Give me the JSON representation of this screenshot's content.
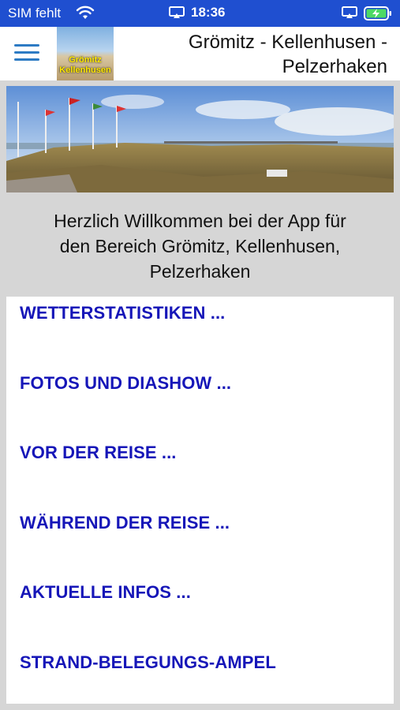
{
  "status_bar": {
    "carrier": "SIM fehlt",
    "time": "18:36"
  },
  "header": {
    "title_line1": "Grömitz - Kellenhusen -",
    "title_line2": "Pelzerhaken",
    "logo_line1": "Grömitz",
    "logo_line2": "Kellenhusen"
  },
  "welcome": {
    "line1": "Herzlich Willkommen bei der App für",
    "line2": "den Bereich Grömitz, Kellenhusen,",
    "line3": "Pelzerhaken"
  },
  "menu": {
    "items": [
      "WETTERSTATISTIKEN ...",
      "FOTOS UND DIASHOW ...",
      "VOR DER REISE ...",
      "WÄHREND DER REISE ...",
      "AKTUELLE INFOS ...",
      "STRAND-BELEGUNGS-AMPEL"
    ]
  },
  "colors": {
    "status_bar": "#1f4fd0",
    "link": "#1616b8",
    "menu_icon": "#2d7bc4"
  }
}
